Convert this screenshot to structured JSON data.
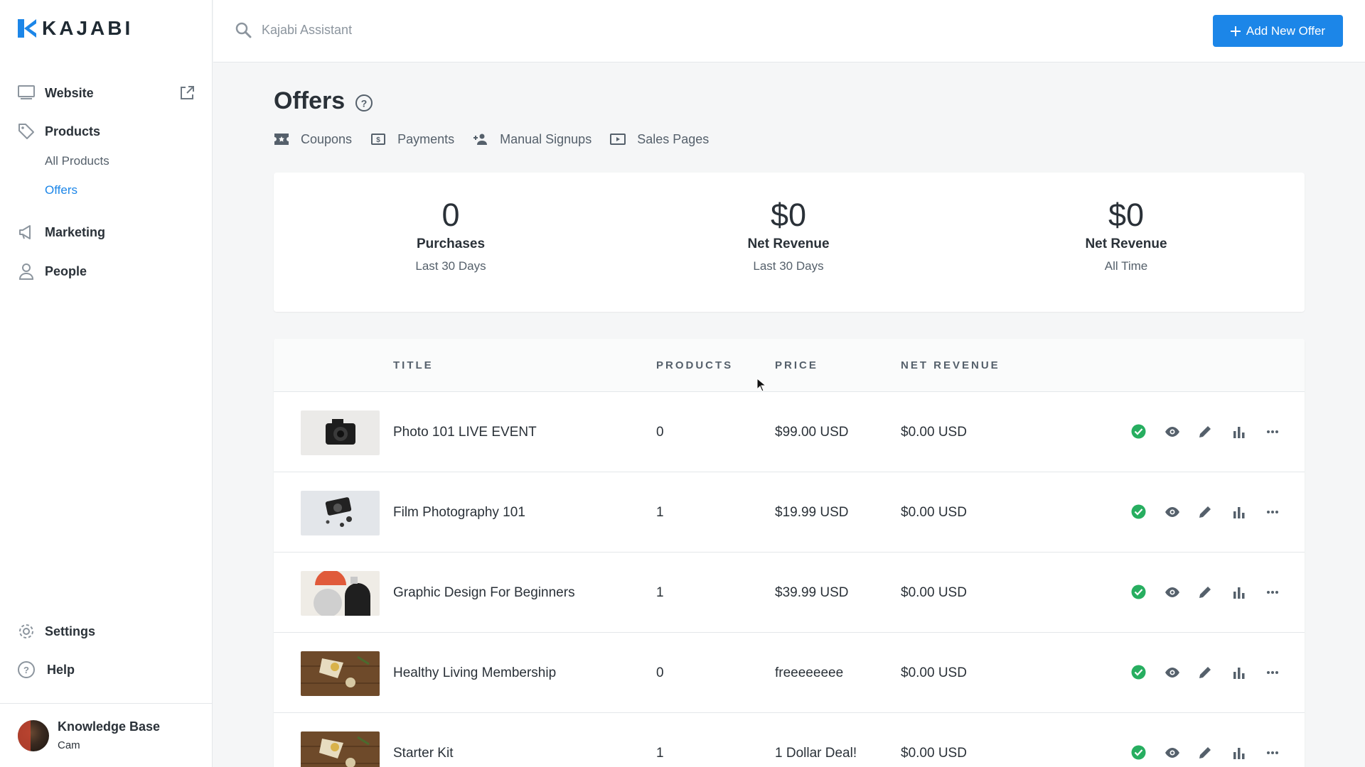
{
  "app": {
    "logo_text": "KAJABI",
    "brand_color": "#1c86e8"
  },
  "sidebar": {
    "items": [
      {
        "label": "Website",
        "icon": "monitor-icon"
      },
      {
        "label": "Products",
        "icon": "tag-icon"
      },
      {
        "label": "Marketing",
        "icon": "megaphone-icon"
      },
      {
        "label": "People",
        "icon": "person-icon"
      }
    ],
    "sub_items": [
      {
        "label": "All Products"
      },
      {
        "label": "Offers",
        "active": true
      }
    ],
    "bottom": [
      {
        "label": "Settings",
        "icon": "gear-icon"
      },
      {
        "label": "Help",
        "icon": "help-icon"
      }
    ],
    "footer": {
      "name": "Knowledge Base",
      "user": "Cam"
    }
  },
  "topbar": {
    "search_placeholder": "Kajabi Assistant",
    "add_button": "Add New Offer"
  },
  "page": {
    "title": "Offers",
    "subnav": [
      {
        "label": "Coupons",
        "icon": "ticket-icon"
      },
      {
        "label": "Payments",
        "icon": "dollar-bill-icon"
      },
      {
        "label": "Manual Signups",
        "icon": "add-person-icon"
      },
      {
        "label": "Sales Pages",
        "icon": "play-screen-icon"
      }
    ]
  },
  "stats": [
    {
      "value": "0",
      "label": "Purchases",
      "sub": "Last 30 Days"
    },
    {
      "value": "$0",
      "label": "Net Revenue",
      "sub": "Last 30 Days"
    },
    {
      "value": "$0",
      "label": "Net Revenue",
      "sub": "All Time"
    }
  ],
  "table": {
    "headers": {
      "title": "TITLE",
      "products": "PRODUCTS",
      "price": "PRICE",
      "net_revenue": "NET REVENUE"
    },
    "rows": [
      {
        "title": "Photo 101 LIVE EVENT",
        "products": "0",
        "price": "$99.00 USD",
        "net_revenue": "$0.00 USD",
        "thumb": "camera-photo"
      },
      {
        "title": "Film Photography 101",
        "products": "1",
        "price": "$19.99 USD",
        "net_revenue": "$0.00 USD",
        "thumb": "film-camera-photo"
      },
      {
        "title": "Graphic Design For Beginners",
        "products": "1",
        "price": "$39.99 USD",
        "net_revenue": "$0.00 USD",
        "thumb": "abstract-shapes-photo"
      },
      {
        "title": "Healthy Living Membership",
        "products": "0",
        "price": "freeeeeeee",
        "net_revenue": "$0.00 USD",
        "thumb": "food-table-photo"
      },
      {
        "title": "Starter Kit",
        "products": "1",
        "price": "1 Dollar Deal!",
        "net_revenue": "$0.00 USD",
        "thumb": "food-table-photo"
      }
    ],
    "row_actions": [
      "published-check-icon",
      "preview-eye-icon",
      "edit-pencil-icon",
      "stats-bar-icon",
      "more-dots-icon"
    ]
  }
}
